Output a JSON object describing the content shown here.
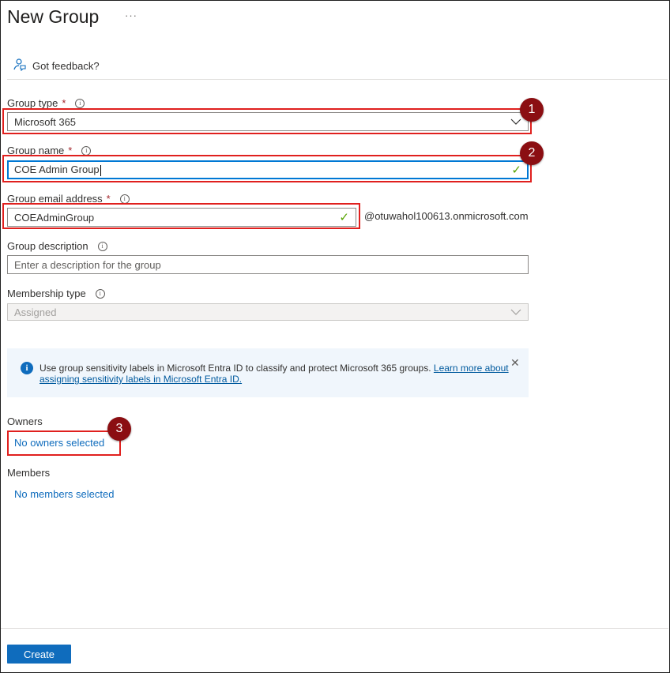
{
  "page": {
    "title": "New Group",
    "more": "···",
    "feedback": "Got feedback?"
  },
  "form": {
    "group_type": {
      "label": "Group type",
      "required": "*",
      "value": "Microsoft 365"
    },
    "group_name": {
      "label": "Group name",
      "required": "*",
      "value": "COE Admin Group"
    },
    "group_email": {
      "label": "Group email address",
      "required": "*",
      "value": "COEAdminGroup",
      "domain_suffix": "@otuwahol100613.onmicrosoft.com"
    },
    "group_description": {
      "label": "Group description",
      "placeholder": "Enter a description for the group"
    },
    "membership_type": {
      "label": "Membership type",
      "value": "Assigned"
    }
  },
  "info_banner": {
    "text": "Use group sensitivity labels in Microsoft Entra ID to classify and protect Microsoft 365 groups. ",
    "link": "Learn more about assigning sensitivity labels in Microsoft Entra ID."
  },
  "owners": {
    "label": "Owners",
    "link": "No owners selected"
  },
  "members": {
    "label": "Members",
    "link": "No members selected"
  },
  "actions": {
    "create": "Create"
  },
  "annotations": {
    "one": "1",
    "two": "2",
    "three": "3"
  },
  "colors": {
    "accent": "#0f6cbd",
    "callout": "#e0201e",
    "badge": "#8b0e12",
    "valid": "#57a300"
  }
}
